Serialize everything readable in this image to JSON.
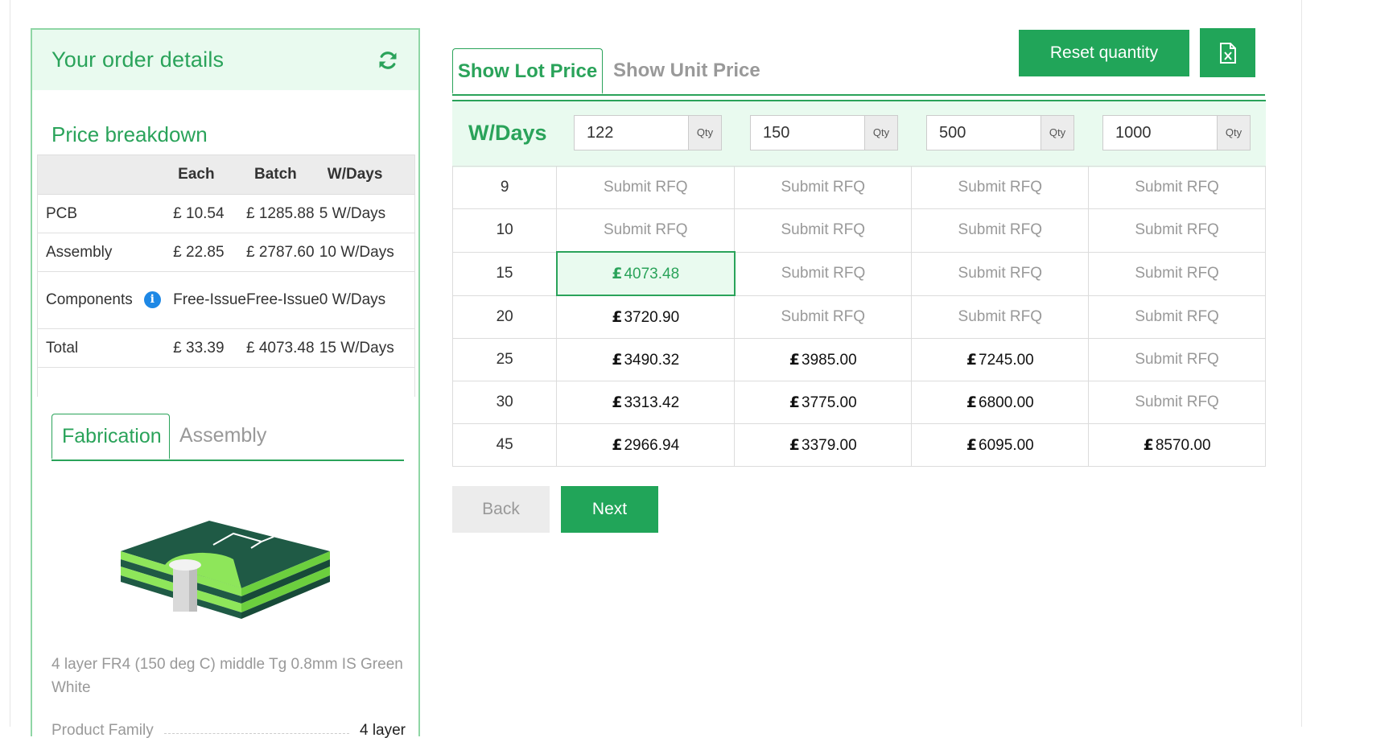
{
  "order": {
    "title": "Your order details",
    "refresh_icon": "refresh-icon"
  },
  "breakdown": {
    "title": "Price breakdown",
    "headers": [
      "",
      "Each",
      "Batch",
      "W/Days"
    ],
    "rows": [
      {
        "label": "PCB",
        "each": "£ 10.54",
        "batch": "£ 1285.88",
        "wdays": "5 W/Days"
      },
      {
        "label": "Assembly",
        "each": "£ 22.85",
        "batch": "£ 2787.60",
        "wdays": "10 W/Days"
      },
      {
        "label": "Components",
        "each": "Free-Issue",
        "batch": "Free-Issue",
        "wdays": "0 W/Days",
        "info_icon": "i"
      },
      {
        "label": "Total",
        "each": "£ 33.39",
        "batch": "£ 4073.48",
        "wdays": "15 W/Days"
      }
    ]
  },
  "sub_tabs": [
    "Fabrication",
    "Assembly"
  ],
  "product": {
    "description": "4 layer FR4 (150 deg C) middle Tg 0.8mm IS Green White",
    "family_label": "Product Family",
    "family_value": "4 layer"
  },
  "price_tabs": [
    "Show Lot Price",
    "Show Unit Price"
  ],
  "toolbar": {
    "reset_label": "Reset quantity",
    "excel_icon": "excel-export-icon"
  },
  "grid": {
    "wdays_label": "W/Days",
    "qty_addon": "Qty",
    "quantities": [
      "122",
      "150",
      "500",
      "1000"
    ],
    "rows": [
      {
        "days": "9",
        "cells": [
          "Submit RFQ",
          "Submit RFQ",
          "Submit RFQ",
          "Submit RFQ"
        ]
      },
      {
        "days": "10",
        "cells": [
          "Submit RFQ",
          "Submit RFQ",
          "Submit RFQ",
          "Submit RFQ"
        ]
      },
      {
        "days": "15",
        "cells": [
          "£4073.48",
          "Submit RFQ",
          "Submit RFQ",
          "Submit RFQ"
        ]
      },
      {
        "days": "20",
        "cells": [
          "£3720.90",
          "Submit RFQ",
          "Submit RFQ",
          "Submit RFQ"
        ]
      },
      {
        "days": "25",
        "cells": [
          "£3490.32",
          "£3985.00",
          "£7245.00",
          "Submit RFQ"
        ]
      },
      {
        "days": "30",
        "cells": [
          "£3313.42",
          "£3775.00",
          "£6800.00",
          "Submit RFQ"
        ]
      },
      {
        "days": "45",
        "cells": [
          "£2966.94",
          "£3379.00",
          "£6095.00",
          "£8570.00"
        ]
      }
    ],
    "selected": {
      "row": 2,
      "col": 0
    }
  },
  "nav": {
    "back_label": "Back",
    "next_label": "Next"
  },
  "colors": {
    "accent": "#21a559",
    "accent_light": "#e9faef",
    "muted": "#999999"
  }
}
